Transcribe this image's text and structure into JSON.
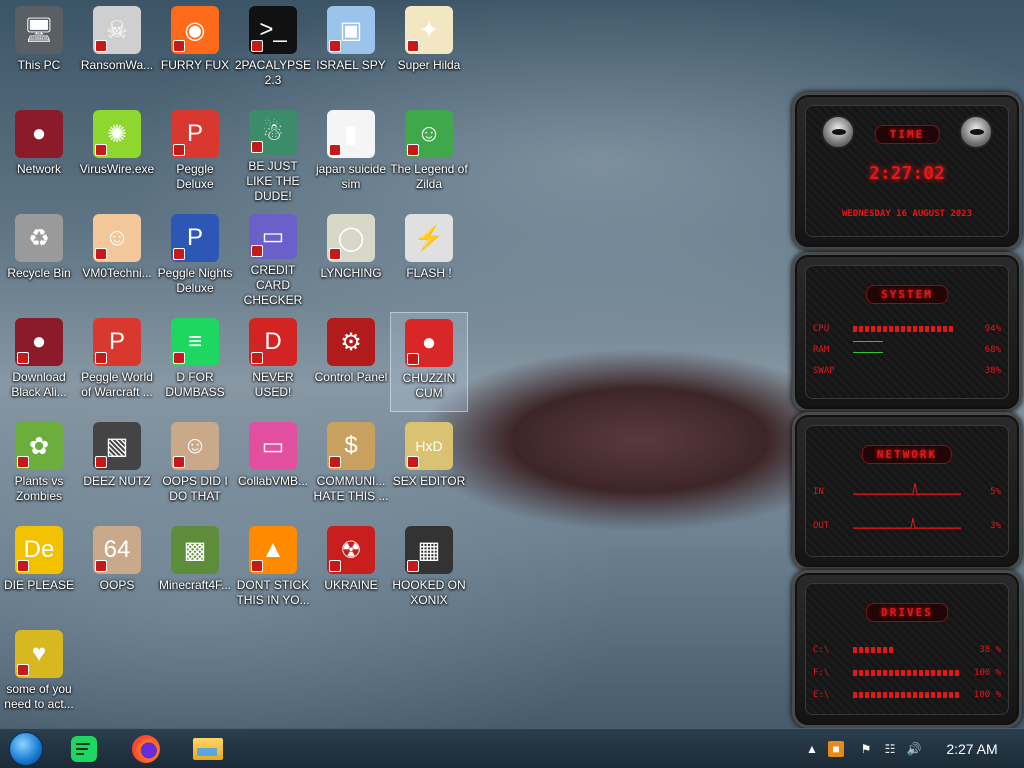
{
  "desktop": {
    "icons": [
      {
        "label": "This PC",
        "icon": "computer-icon"
      },
      {
        "label": "RansomWa...",
        "icon": "skull-icon"
      },
      {
        "label": "FURRY FUX",
        "icon": "firefox-icon"
      },
      {
        "label": "2PACALYPSE 2.3",
        "icon": "terminal-icon"
      },
      {
        "label": "ISRAEL SPY",
        "icon": "network-computers-icon"
      },
      {
        "label": "Super Hilda",
        "icon": "pixel-dog-icon"
      },
      {
        "label": "Network",
        "icon": "alien-orb-icon"
      },
      {
        "label": "VirusWire.exe",
        "icon": "lime-icon"
      },
      {
        "label": "Peggle Deluxe",
        "icon": "peggle-icon"
      },
      {
        "label": "BE JUST LIKE THE DUDE!",
        "icon": "santa-globe-icon"
      },
      {
        "label": "japan suicide sim",
        "icon": "game-box-icon"
      },
      {
        "label": "The Legend of Zilda",
        "icon": "pixel-hero-icon"
      },
      {
        "label": "Recycle Bin",
        "icon": "recycle-bin-icon"
      },
      {
        "label": "VM0Techni...",
        "icon": "doctor-icon"
      },
      {
        "label": "Peggle Nights Deluxe",
        "icon": "peggle-nights-icon"
      },
      {
        "label": "CREDIT CARD CHECKER",
        "icon": "credit-card-icon"
      },
      {
        "label": "LYNCHING",
        "icon": "noose-icon"
      },
      {
        "label": "FLASH !",
        "icon": "flash-icon"
      },
      {
        "label": "Download Black Ali...",
        "icon": "alien-orb-icon"
      },
      {
        "label": "Peggle World of Warcraft ...",
        "icon": "peggle-wow-icon"
      },
      {
        "label": "D FOR DUMBASS",
        "icon": "spotify-icon"
      },
      {
        "label": "NEVER USED!",
        "icon": "devcpp-icon"
      },
      {
        "label": "Control Panel",
        "icon": "control-panel-icon"
      },
      {
        "label": "CHUZZIN CUM",
        "icon": "chuzzle-icon"
      },
      {
        "label": "Plants vs Zombies",
        "icon": "flower-icon"
      },
      {
        "label": "DEEZ NUTZ",
        "icon": "stacked-windows-icon"
      },
      {
        "label": "OOPS DID I DO THAT",
        "icon": "portrait-icon"
      },
      {
        "label": "CollabVMB...",
        "icon": "monitor-icon"
      },
      {
        "label": "COMMUNI... HATE THIS ...",
        "icon": "money-bag-icon"
      },
      {
        "label": "SEX EDITOR",
        "icon": "hxd-icon"
      },
      {
        "label": "DIE PLEASE",
        "icon": "de-icon"
      },
      {
        "label": "OOPS",
        "icon": "portrait-64-icon"
      },
      {
        "label": "Minecraft4F...",
        "icon": "grass-block-icon"
      },
      {
        "label": "DONT STICK THIS IN YO...",
        "icon": "vlc-cone-icon"
      },
      {
        "label": "UKRAINE",
        "icon": "radiation-icon"
      },
      {
        "label": "HOOKED ON XONIX",
        "icon": "xonix-icon"
      },
      {
        "label": "some of you need to act...",
        "icon": "dog-icon"
      }
    ]
  },
  "widget": {
    "time_title": "TIME",
    "time": "2:27:02",
    "date": "WEDNESDAY 16 AUGUST 2023",
    "system_title": "SYSTEM",
    "cpu_label": "CPU",
    "cpu_value": "94%",
    "cpu_fill": 94,
    "ram_label": "RAM",
    "ram_value": "68%",
    "swap_label": "SWAP",
    "swap_value": "38%",
    "network_title": "NETWORK",
    "in_label": "IN",
    "in_value": "5%",
    "out_label": "OUT",
    "out_value": "3%",
    "drives_title": "DRIVES",
    "c_label": "C:\\",
    "c_value": "38 %",
    "c_fill": 38,
    "f_label": "F:\\",
    "f_value": "100 %",
    "f_fill": 100,
    "e_label": "E:\\",
    "e_value": "100 %",
    "e_fill": 100
  },
  "taskbar": {
    "clock": "2:27 AM"
  },
  "colors": {
    "widget_red": "#e21818",
    "taskbar": "#1f3344"
  }
}
